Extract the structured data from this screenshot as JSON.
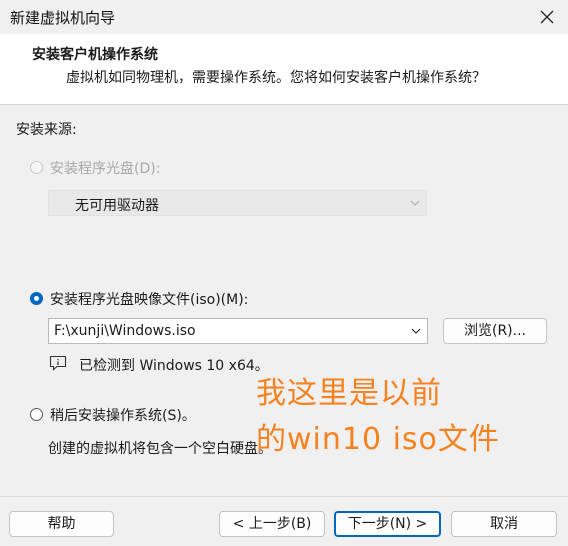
{
  "window": {
    "title": "新建虚拟机向导"
  },
  "header": {
    "title": "安装客户机操作系统",
    "subtitle": "虚拟机如同物理机，需要操作系统。您将如何安装客户机操作系统？"
  },
  "source": {
    "label": "安装来源:",
    "options": [
      {
        "label": "安装程序光盘(D):",
        "selected": false,
        "enabled": false,
        "dropdown_value": "无可用驱动器"
      },
      {
        "label": "安装程序光盘映像文件(iso)(M):",
        "selected": true,
        "enabled": true,
        "path_value": "F:\\xunji\\Windows.iso",
        "browse_label": "浏览(R)...",
        "detected_text": "已检测到 Windows 10 x64。"
      },
      {
        "label": "稍后安装操作系统(S)。",
        "selected": false,
        "enabled": true,
        "description": "创建的虚拟机将包含一个空白硬盘。"
      }
    ]
  },
  "annotation": {
    "line1": "我这里是以前",
    "line2": "的win10 iso文件",
    "color": "#f5821f"
  },
  "footer": {
    "help": "帮助",
    "back": "< 上一步(B)",
    "next": "下一步(N) >",
    "cancel": "取消"
  },
  "colors": {
    "accent": "#0067c0",
    "dialog_bg": "#f0f0f0",
    "header_bg": "#ffffff"
  },
  "icons": {
    "close": "close-icon",
    "dropdown": "chevron-down-icon",
    "info": "info-icon"
  }
}
